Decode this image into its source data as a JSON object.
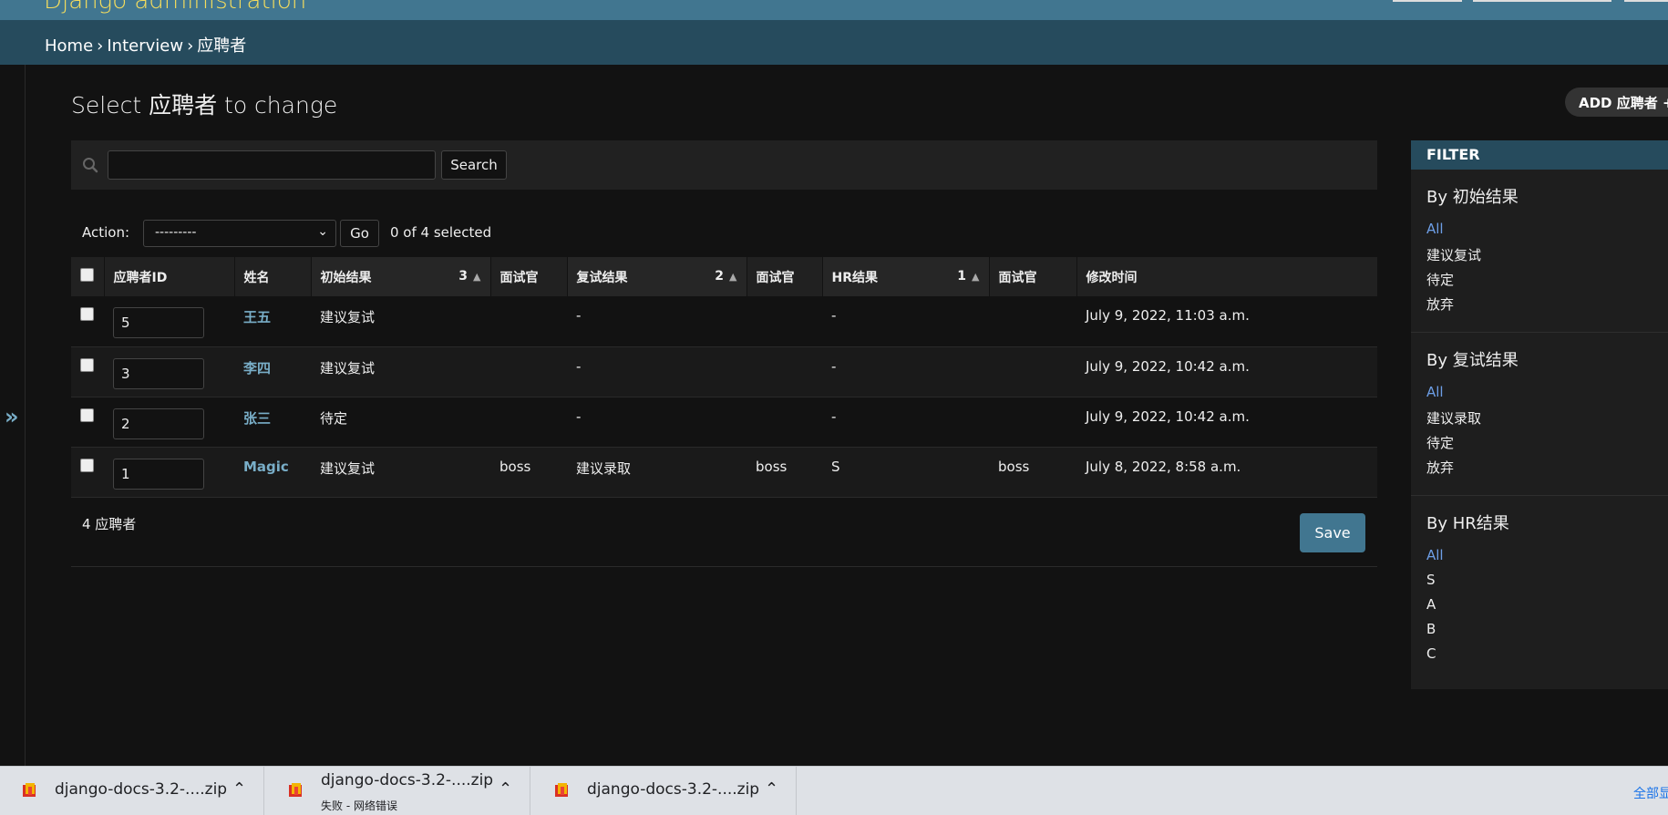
{
  "header": {
    "site_name": "Django administration"
  },
  "breadcrumbs": {
    "home": "Home",
    "app": "Interview",
    "model": "应聘者",
    "sep": "›"
  },
  "page": {
    "title": "Select 应聘者 to change",
    "add_label": "ADD 应聘者 +"
  },
  "search": {
    "value": "",
    "placeholder": "",
    "button": "Search"
  },
  "actions": {
    "label": "Action:",
    "selected": "---------",
    "go": "Go",
    "counter": "0 of 4 selected"
  },
  "table": {
    "columns": [
      "应聘者ID",
      "姓名",
      "初始结果",
      "面试官",
      "复试结果",
      "面试官",
      "HR结果",
      "面试官",
      "修改时间"
    ],
    "sort_priority": {
      "first": "3",
      "second": "2",
      "third": "1"
    },
    "rows": [
      {
        "id": "5",
        "name": "王五",
        "first_result": "建议复试",
        "first_interviewer": "",
        "second_result": "-",
        "second_interviewer": "",
        "hr_result": "-",
        "hr_interviewer": "",
        "modified": "July 9, 2022, 11:03 a.m."
      },
      {
        "id": "3",
        "name": "李四",
        "first_result": "建议复试",
        "first_interviewer": "",
        "second_result": "-",
        "second_interviewer": "",
        "hr_result": "-",
        "hr_interviewer": "",
        "modified": "July 9, 2022, 10:42 a.m."
      },
      {
        "id": "2",
        "name": "张三",
        "first_result": "待定",
        "first_interviewer": "",
        "second_result": "-",
        "second_interviewer": "",
        "hr_result": "-",
        "hr_interviewer": "",
        "modified": "July 9, 2022, 10:42 a.m."
      },
      {
        "id": "1",
        "name": "Magic",
        "first_result": "建议复试",
        "first_interviewer": "boss",
        "second_result": "建议录取",
        "second_interviewer": "boss",
        "hr_result": "S",
        "hr_interviewer": "boss",
        "modified": "July 8, 2022, 8:58 a.m."
      }
    ]
  },
  "paginator": {
    "count": "4 应聘者",
    "save": "Save"
  },
  "filter": {
    "title": "FILTER",
    "groups": [
      {
        "title": "By 初始结果",
        "items": [
          "All",
          "建议复试",
          "待定",
          "放弃"
        ]
      },
      {
        "title": "By 复试结果",
        "items": [
          "All",
          "建议录取",
          "待定",
          "放弃"
        ]
      },
      {
        "title": "By HR结果",
        "items": [
          "All",
          "S",
          "A",
          "B",
          "C"
        ]
      }
    ]
  },
  "downloads": {
    "items": [
      {
        "name": "django-docs-3.2-....zip",
        "status": ""
      },
      {
        "name": "django-docs-3.2-....zip",
        "status": "失败 - 网络错误"
      },
      {
        "name": "django-docs-3.2-....zip",
        "status": ""
      }
    ],
    "show_all": "全部显示"
  },
  "colors": {
    "header": "#417690",
    "breadcrumbs": "#264b5d",
    "link": "#79aec8",
    "selected_filter": "#6d9ee6",
    "save_button": "#417690",
    "site_name": "#f5dd5d"
  },
  "icons": {
    "search": "search-icon",
    "nav_toggle": "double-chevron-right-icon",
    "file": "file-archive-icon",
    "chevron": "chevron-up-icon",
    "sort": "triangle-up-icon"
  }
}
